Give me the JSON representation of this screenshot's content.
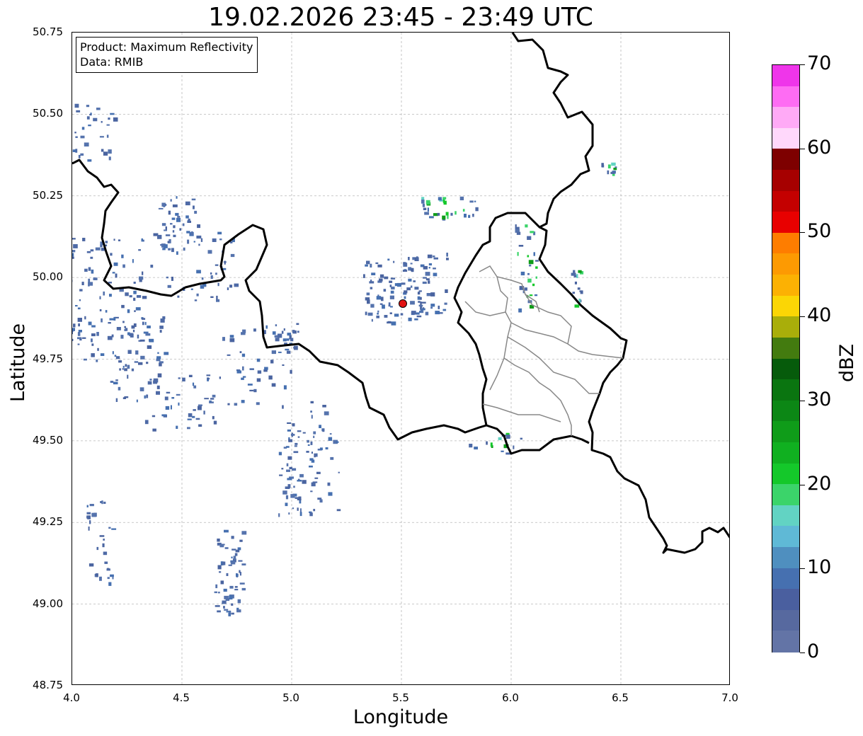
{
  "title": "19.02.2026 23:45 - 23:49 UTC",
  "info": {
    "product": "Product: Maximum Reflectivity",
    "data": "Data: RMIB"
  },
  "axes": {
    "xlabel": "Longitude",
    "ylabel": "Latitude",
    "xticks": [
      "4.0",
      "4.5",
      "5.0",
      "5.5",
      "6.0",
      "6.5",
      "7.0"
    ],
    "yticks": [
      "50.75",
      "50.50",
      "50.25",
      "50.00",
      "49.75",
      "49.50",
      "49.25",
      "49.00",
      "48.75"
    ],
    "xlim": [
      4.0,
      7.0
    ],
    "ylim": [
      48.75,
      50.75
    ],
    "grid": true
  },
  "colorbar": {
    "label": "dBZ",
    "ticks": [
      "0",
      "10",
      "20",
      "30",
      "40",
      "50",
      "60",
      "70"
    ],
    "range": [
      0,
      70
    ],
    "colors": [
      "#6374a6",
      "#57699f",
      "#4a5f9f",
      "#4670b0",
      "#4f8fbf",
      "#5fb9d6",
      "#62d3c3",
      "#3bd46a",
      "#14c82a",
      "#10b020",
      "#0f9c19",
      "#0c8715",
      "#0a7510",
      "#065b0b",
      "#437b0f",
      "#a9ae0a",
      "#fbd605",
      "#fcb103",
      "#fd9a02",
      "#fe7d00",
      "#e80000",
      "#c40000",
      "#a60000",
      "#7e0000",
      "#ffd8fb",
      "#ffaaf6",
      "#fe6cf3",
      "#ef35ea"
    ]
  },
  "map": {
    "radar_site": {
      "lon": 5.51,
      "lat": 49.92,
      "color": "#e11212"
    }
  }
}
